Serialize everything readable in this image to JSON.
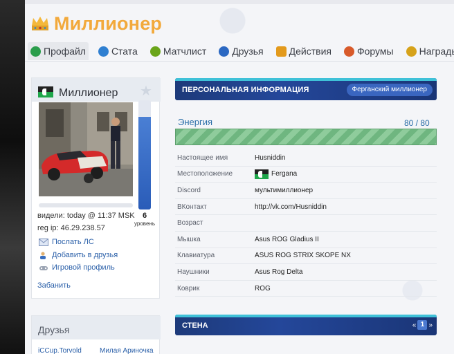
{
  "header": {
    "title": "Миллионер"
  },
  "tabs": [
    {
      "label": "Профайл",
      "icon": "smiley-icon",
      "color": "#2a9d4b"
    },
    {
      "label": "Стата",
      "icon": "info-icon",
      "color": "#2f7fd1"
    },
    {
      "label": "Матчлист",
      "icon": "radiation-icon",
      "color": "#6aa51a"
    },
    {
      "label": "Друзья",
      "icon": "people-icon",
      "color": "#2b68c2"
    },
    {
      "label": "Действия",
      "icon": "notebook-icon",
      "color": "#e39a1c"
    },
    {
      "label": "Форумы",
      "icon": "chat-icon",
      "color": "#d85a2a"
    },
    {
      "label": "Награды",
      "icon": "medal-icon",
      "color": "#d6a21a"
    }
  ],
  "profile": {
    "username": "Миллионер",
    "level": "6",
    "level_label": "уровень",
    "level_fill_fraction": 0.85,
    "seen": "видели: today @ 11:37 MSK",
    "reg_ip": "reg ip: 46.29.238.57",
    "actions": [
      {
        "label": "Послать ЛС",
        "icon": "envelope-icon"
      },
      {
        "label": "Добавить в друзья",
        "icon": "add-user-icon"
      },
      {
        "label": "Игровой профиль",
        "icon": "game-profile-icon"
      }
    ],
    "ban_label": "Забанить"
  },
  "friends": {
    "title": "Друзья",
    "items": [
      "iCCup.Torvold",
      "Милая Ариночка"
    ]
  },
  "personal_info": {
    "title": "ПЕРСОНАЛЬНАЯ ИНФОРМАЦИЯ",
    "badge": "Ферганский миллионер",
    "energy_label": "Энергия",
    "energy_value": "80 / 80",
    "energy_fraction": 1.0,
    "rows": [
      {
        "key": "Настоящее имя",
        "value": "Husniddin"
      },
      {
        "key": "Местоположение",
        "value": "Fergana"
      },
      {
        "key": "Discord",
        "value": "мультимиллионер"
      },
      {
        "key": "ВКонтакт",
        "value": "http://vk.com/Husniddin"
      },
      {
        "key": "Возраст",
        "value": ""
      },
      {
        "key": "Мышка",
        "value": "Asus ROG Gladius II"
      },
      {
        "key": "Клавиатура",
        "value": "ASUS ROG STRIX SKOPE NX"
      },
      {
        "key": "Наушники",
        "value": "Asus Rog Delta"
      },
      {
        "key": "Коврик",
        "value": "ROG"
      }
    ]
  },
  "wall": {
    "title": "СТЕНА",
    "prev": "«",
    "page": "1",
    "next": "»"
  }
}
